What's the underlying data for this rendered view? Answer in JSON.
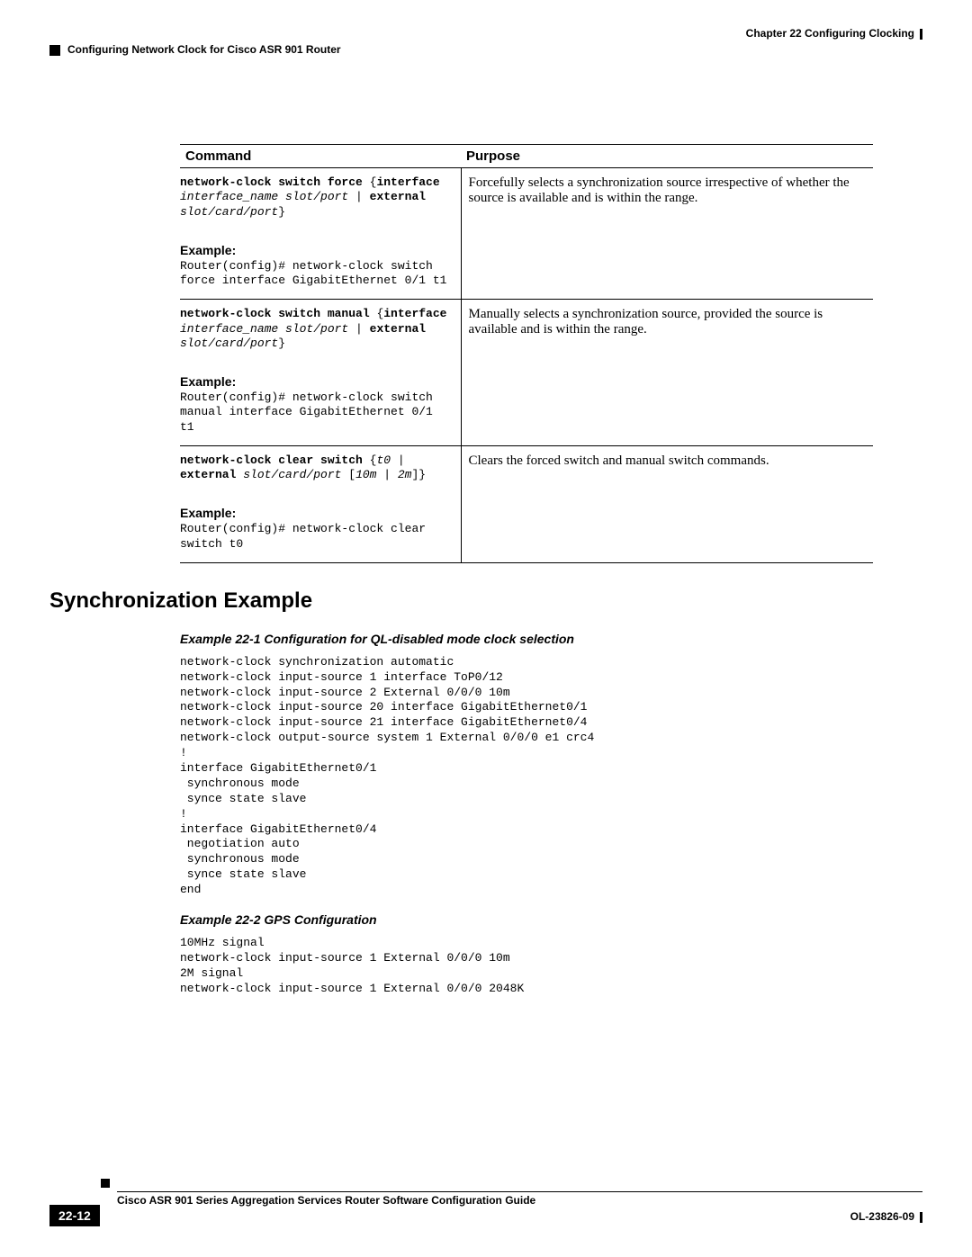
{
  "header": {
    "chapter": "Chapter 22    Configuring Clocking",
    "section": "Configuring Network Clock for Cisco ASR 901 Router"
  },
  "table": {
    "col1": "Command",
    "col2": "Purpose",
    "rows": [
      {
        "cmd_b1": "network-clock switch force",
        "cmd_p1": " {",
        "cmd_b2": "interface",
        "cmd_i1": "\ninterface_name slot/port",
        "cmd_p2": " | ",
        "cmd_b3": "external",
        "cmd_i2": "\nslot/card/port",
        "cmd_p3": "}",
        "ex_label": "Example:",
        "ex_text": "Router(config)# network-clock switch\nforce interface GigabitEthernet 0/1 t1",
        "purpose": "Forcefully selects a synchronization source irrespective of whether the source is available and is within the range."
      },
      {
        "cmd_b1": "network-clock switch manual",
        "cmd_p1": " {",
        "cmd_b2": "interface",
        "cmd_i1": "\ninterface_name slot/port",
        "cmd_p2": " | ",
        "cmd_b3": "external",
        "cmd_i2": "\nslot/card/port",
        "cmd_p3": "}",
        "ex_label": "Example:",
        "ex_text": "Router(config)# network-clock switch\nmanual interface GigabitEthernet 0/1 t1",
        "purpose": "Manually selects a synchronization source, provided the source is available and is within the range."
      },
      {
        "cmd_b1": "network-clock clear switch",
        "cmd_p1": " {",
        "cmd_i0": "t0",
        "cmd_p1b": " |\n",
        "cmd_b2": "external",
        "cmd_i1": " slot/card/port",
        "cmd_p2": " [",
        "cmd_i2": "10m | 2m",
        "cmd_p3": "]}",
        "ex_label": "Example:",
        "ex_text": "Router(config)# network-clock clear\nswitch t0",
        "purpose": "Clears the forced switch and manual switch commands."
      }
    ]
  },
  "heading": "Synchronization Example",
  "example1": {
    "caption": "Example 22-1   Configuration for QL-disabled mode clock selection",
    "code": "network-clock synchronization automatic\nnetwork-clock input-source 1 interface ToP0/12\nnetwork-clock input-source 2 External 0/0/0 10m\nnetwork-clock input-source 20 interface GigabitEthernet0/1\nnetwork-clock input-source 21 interface GigabitEthernet0/4\nnetwork-clock output-source system 1 External 0/0/0 e1 crc4\n!\ninterface GigabitEthernet0/1\n synchronous mode\n synce state slave\n!\ninterface GigabitEthernet0/4\n negotiation auto\n synchronous mode\n synce state slave\nend"
  },
  "example2": {
    "caption": "Example 22-2   GPS Configuration",
    "code": "10MHz signal\nnetwork-clock input-source 1 External 0/0/0 10m\n2M signal\nnetwork-clock input-source 1 External 0/0/0 2048K"
  },
  "footer": {
    "title": "Cisco ASR 901 Series Aggregation Services Router Software Configuration Guide",
    "page": "22-12",
    "doc": "OL-23826-09"
  }
}
